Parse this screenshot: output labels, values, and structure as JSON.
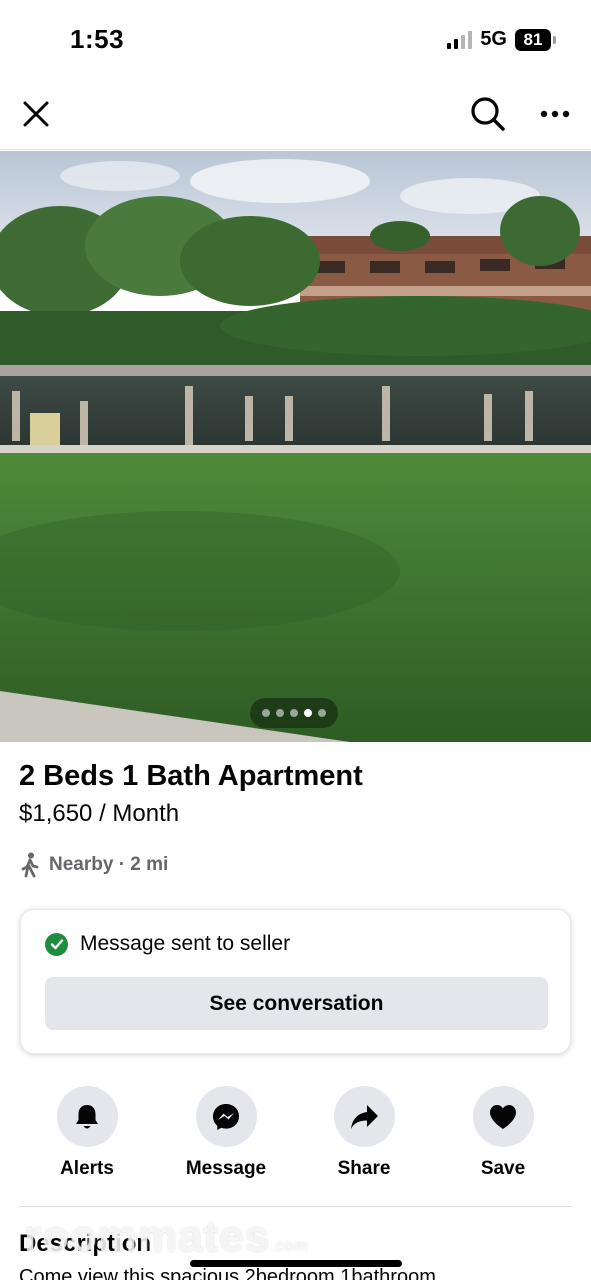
{
  "status_bar": {
    "time": "1:53",
    "network": "5G",
    "battery": "81"
  },
  "nav": {
    "close_icon": "close-icon",
    "search_icon": "search-icon",
    "more_icon": "more-icon"
  },
  "gallery": {
    "photo_count": 5,
    "active_index": 3
  },
  "listing": {
    "title": "2 Beds 1 Bath Apartment",
    "price": "$1,650 / Month",
    "location": "Nearby · 2 mi"
  },
  "message_card": {
    "status": "Message sent to seller",
    "button_label": "See conversation",
    "status_color": "#1e8e3e"
  },
  "actions": [
    {
      "label": "Alerts",
      "icon": "bell-icon"
    },
    {
      "label": "Message",
      "icon": "messenger-icon"
    },
    {
      "label": "Share",
      "icon": "share-arrow-icon"
    },
    {
      "label": "Save",
      "icon": "heart-icon"
    }
  ],
  "description": {
    "heading": "Description",
    "text": "Come view this spacious 2bedroom 1bathroom"
  },
  "watermark": {
    "text": "roommates",
    "suffix": ".com"
  }
}
